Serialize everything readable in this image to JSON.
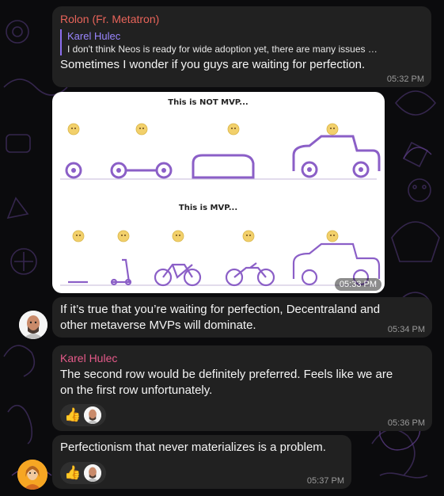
{
  "messages": [
    {
      "sender": "Rolon (Fr. Metatron)",
      "reply_to": {
        "name": "Karel Hulec",
        "text": "I don't think Neos is ready for wide adoption yet, there are many issues …"
      },
      "text": "Sometimes I wonder if you guys are waiting for perfection.",
      "time": "05:32 PM"
    },
    {
      "image": {
        "row1_label": "This is NOT MVP...",
        "row2_label": "This is MVP..."
      },
      "time": "05:33 PM"
    },
    {
      "text_line1": "If it’s true that you’re waiting for perfection, Decentraland and",
      "text_line2": "other metaverse MVPs will dominate.",
      "time": "05:34 PM"
    },
    {
      "sender": "Karel Hulec",
      "text_line1": "The second row would be definitely preferred. Feels like we are",
      "text_line2": "on the first row unfortunately.",
      "reaction": "👍",
      "time": "05:36 PM"
    },
    {
      "text": "Perfectionism that never materializes is a problem.",
      "reaction": "👍",
      "time": "05:37 PM"
    }
  ],
  "colors": {
    "sender_rolon": "#e8645a",
    "sender_karel": "#e65a8a",
    "reply_accent": "#8d6ff0",
    "bubble_bg": "#212121",
    "page_bg": "#0b0b0d",
    "mvp_purple": "#8b5fc7"
  },
  "icons": [
    "thumbs-up-icon",
    "avatar-bald-man",
    "avatar-orange-woman"
  ]
}
